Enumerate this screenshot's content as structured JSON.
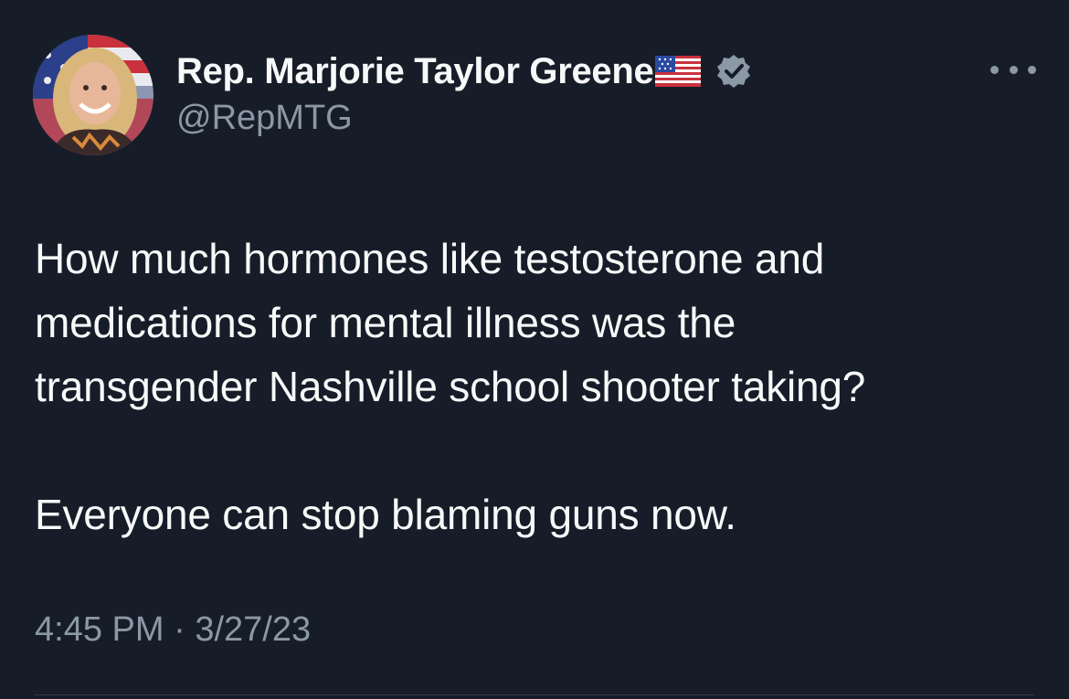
{
  "author": {
    "display_name": "Rep. Marjorie Taylor Greene",
    "handle": "@RepMTG",
    "flag_icon": "us-flag-icon",
    "verified_icon": "verified-badge-icon",
    "verified_color": "#8b98a5"
  },
  "tweet": {
    "lines_paragraph1": [
      "How much hormones like testosterone and",
      "medications for mental illness was the",
      "transgender Nashville school shooter taking?"
    ],
    "paragraph2": "Everyone can stop blaming guns now.",
    "time": "4:45 PM",
    "separator": "·",
    "date": "3/27/23"
  },
  "menu": {
    "icon": "more-options-icon"
  },
  "colors": {
    "background": "#171d28",
    "text": "#f7f9f9",
    "secondary": "#8b98a5"
  }
}
